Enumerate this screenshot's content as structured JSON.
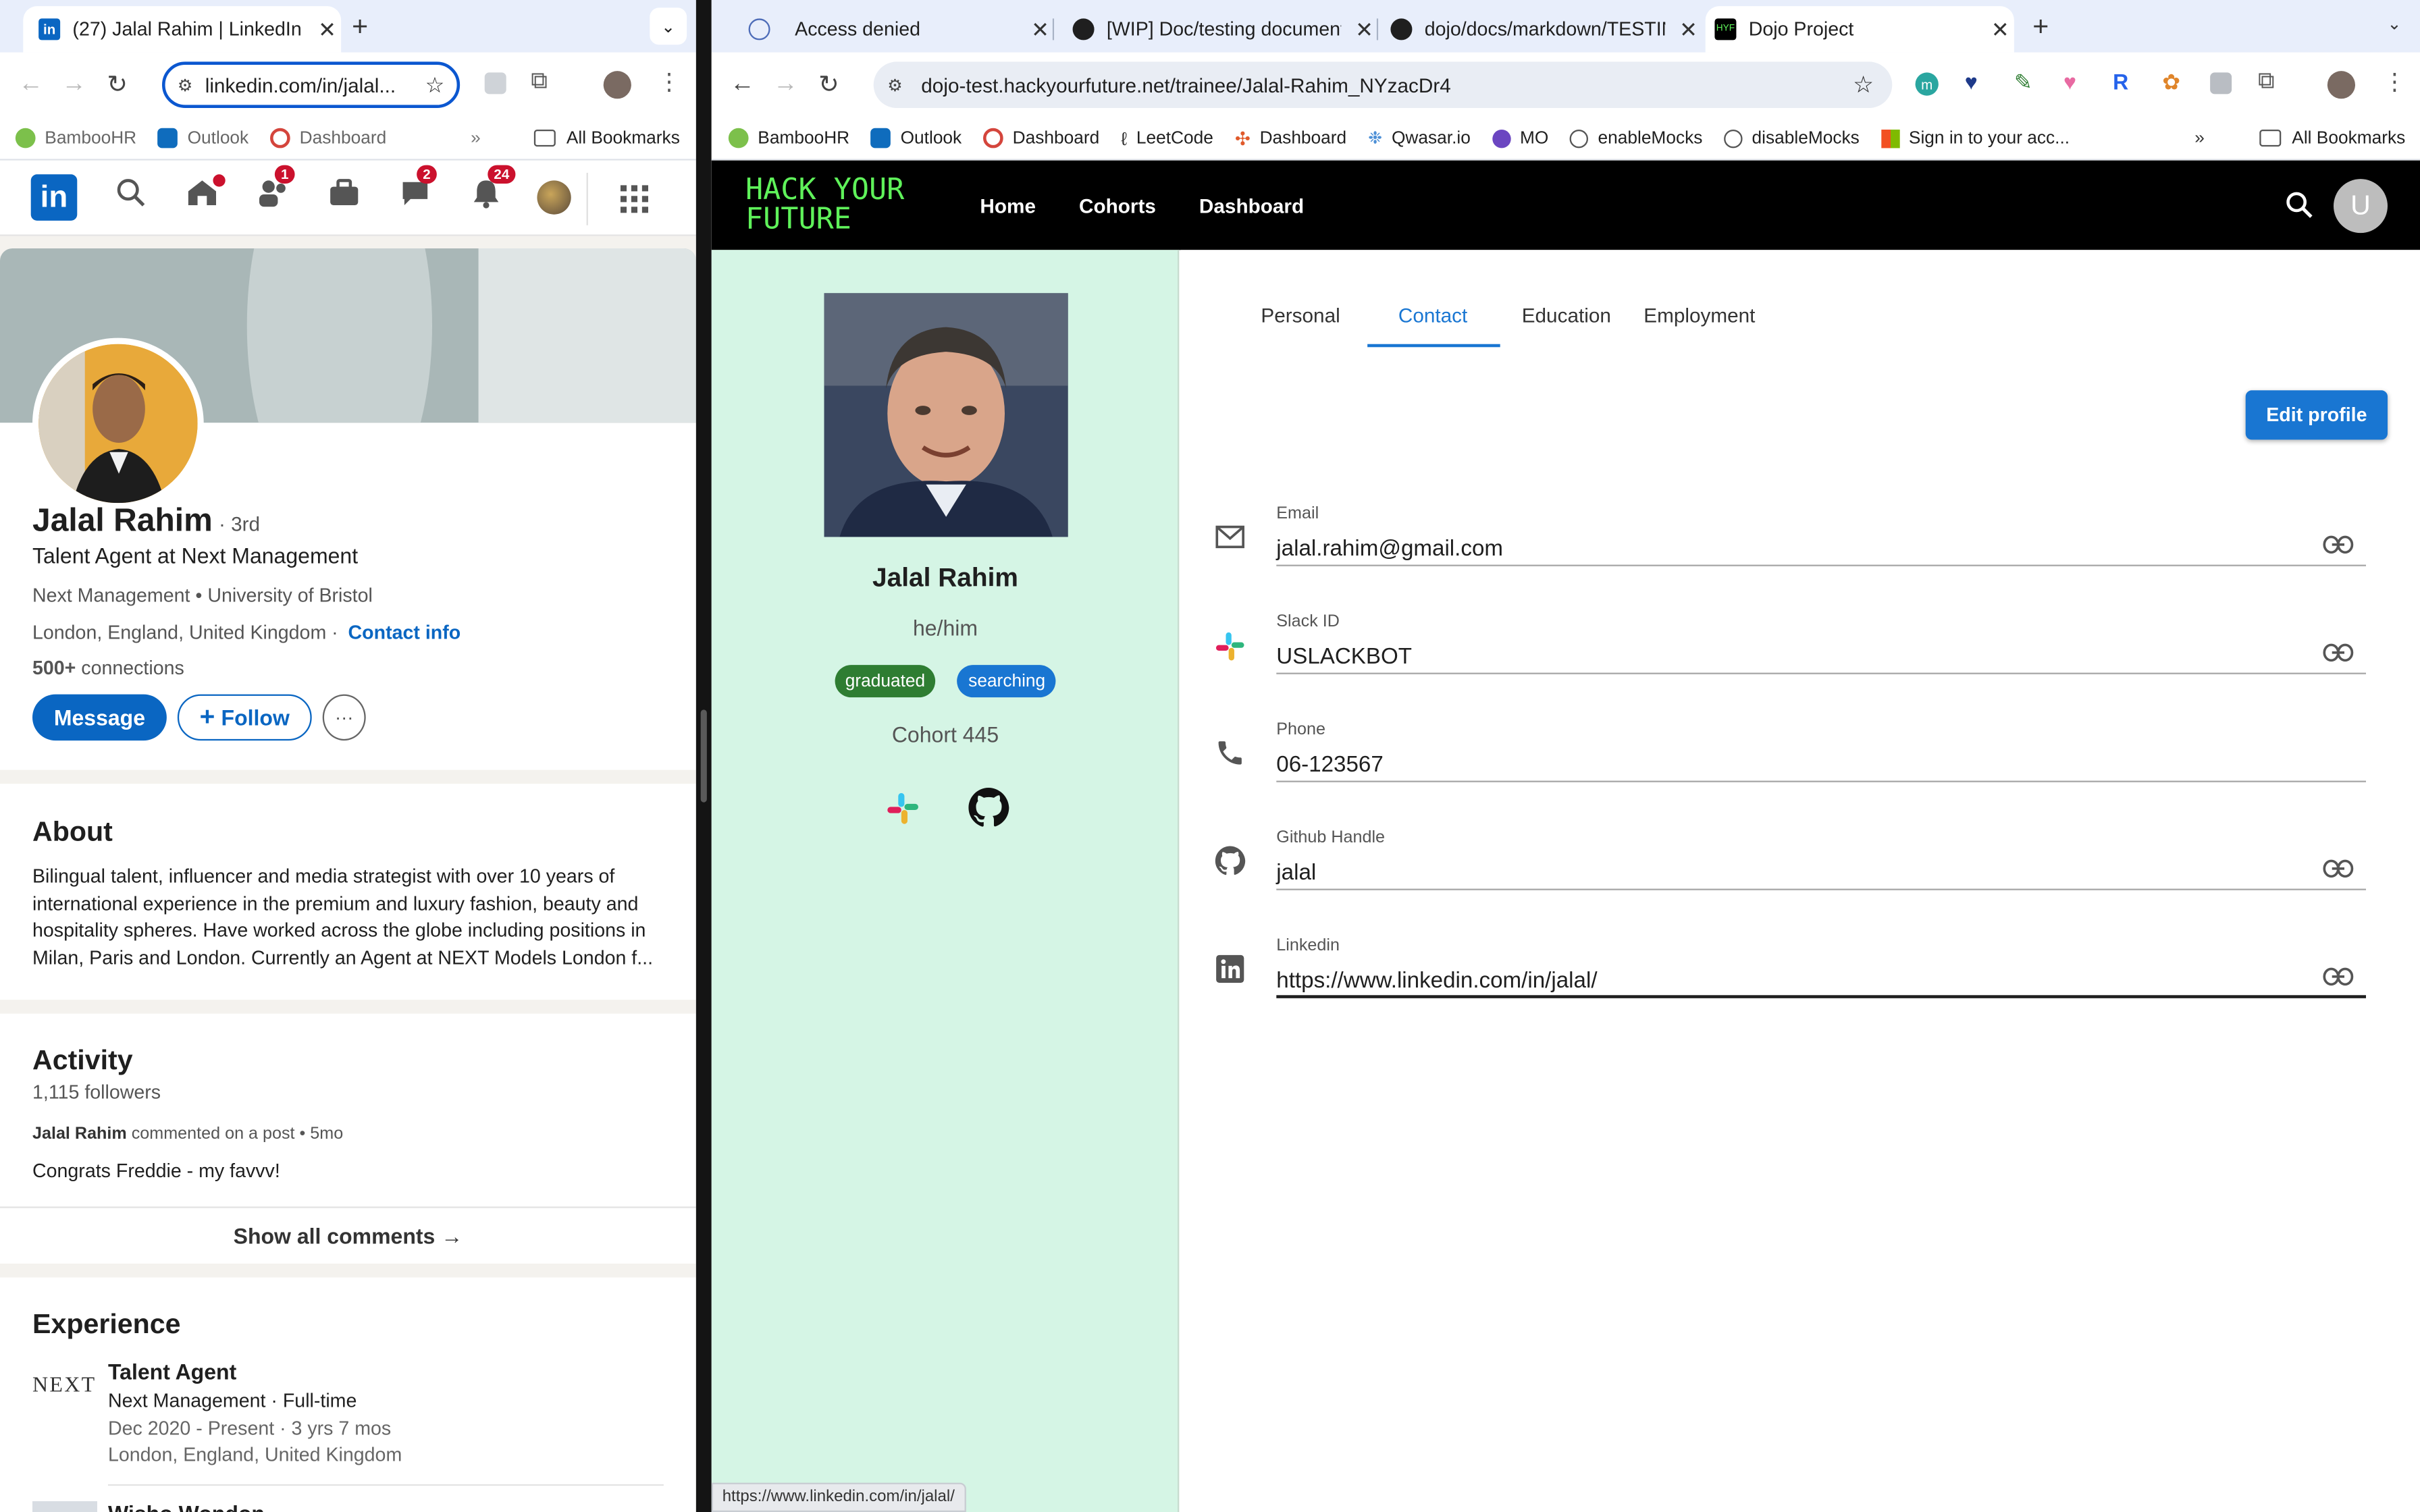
{
  "left": {
    "tab": {
      "label": "(27) Jalal Rahim | LinkedIn"
    },
    "url": "linkedin.com/in/jalal...",
    "bookmarks": [
      "BambooHR",
      "Outlook",
      "Dashboard"
    ],
    "all_bookmarks": "All Bookmarks",
    "nav_badges": {
      "home": "",
      "network": "1",
      "messaging": "2",
      "notifications": "24"
    },
    "profile": {
      "name": "Jalal Rahim",
      "degree": "· 3rd",
      "headline": "Talent Agent at Next Management",
      "education": "Next Management • University of Bristol",
      "location": "London, England, United Kingdom ·",
      "contact_info": "Contact info",
      "connections_count": "500+",
      "connections_label": " connections",
      "message": "Message",
      "follow": "Follow",
      "more": "···"
    },
    "about": {
      "title": "About",
      "text": "Bilingual talent, influencer and media strategist with over 10 years of international experience in the premium and luxury fashion, beauty and hospitality spheres. Have worked across the globe including positions in Milan, Paris and London. Currently an Agent at NEXT Models London f..."
    },
    "activity": {
      "title": "Activity",
      "followers": "1,115 followers",
      "meta_name": "Jalal Rahim",
      "meta_rest": " commented on a post • 5mo",
      "comment": "Congrats Freddie - my favvv!",
      "show_all": "Show all comments →"
    },
    "experience": {
      "title": "Experience",
      "logo": "NEXT",
      "role": "Talent Agent",
      "company": "Next Management · Full-time",
      "dates": "Dec 2020 - Present · 3 yrs 7 mos",
      "location": "London, England, United Kingdom",
      "next_role": "Wisho Wondon"
    }
  },
  "right": {
    "tabs": [
      {
        "label": "Access denied"
      },
      {
        "label": "[WIP] Doc/testing document f"
      },
      {
        "label": "dojo/docs/markdown/TESTING"
      },
      {
        "label": "Dojo Project"
      }
    ],
    "url": "dojo-test.hackyourfuture.net/trainee/Jalal-Rahim_NYzacDr4",
    "bookmarks": [
      "BambooHR",
      "Outlook",
      "Dashboard",
      "LeetCode",
      "Dashboard",
      "Qwasar.io",
      "MO",
      "enableMocks",
      "disableMocks",
      "Sign in to your acc..."
    ],
    "all_bookmarks": "All Bookmarks",
    "app": {
      "logo_line1": "HACK YOUR",
      "logo_line2": "FUTURE",
      "nav": [
        "Home",
        "Cohorts",
        "Dashboard"
      ],
      "avatar_letter": "U"
    },
    "trainee": {
      "name": "Jalal Rahim",
      "pronouns": "he/him",
      "chips": [
        {
          "label": "graduated",
          "color": "#2e7d32"
        },
        {
          "label": "searching",
          "color": "#1976d2"
        }
      ],
      "cohort": "Cohort 445"
    },
    "profile_tabs": [
      "Personal",
      "Contact",
      "Education",
      "Employment"
    ],
    "active_tab": "Contact",
    "edit_profile": "Edit profile",
    "fields": [
      {
        "label": "Email",
        "value": "jalal.rahim@gmail.com",
        "icon": "mail-icon"
      },
      {
        "label": "Slack ID",
        "value": "USLACKBOT",
        "icon": "slack-icon"
      },
      {
        "label": "Phone",
        "value": "06-123567",
        "icon": "phone-icon"
      },
      {
        "label": "Github Handle",
        "value": "jalal",
        "icon": "github-icon"
      },
      {
        "label": "Linkedin",
        "value": "https://www.linkedin.com/in/jalal/",
        "icon": "linkedin-icon"
      }
    ],
    "status_url": "https://www.linkedin.com/in/jalal/"
  },
  "colors": {
    "linkedin_blue": "#0a66c2",
    "hyf_green": "#5ff25a",
    "sidebar_bg": "#d5f5e5",
    "accent_blue": "#1976d2"
  }
}
